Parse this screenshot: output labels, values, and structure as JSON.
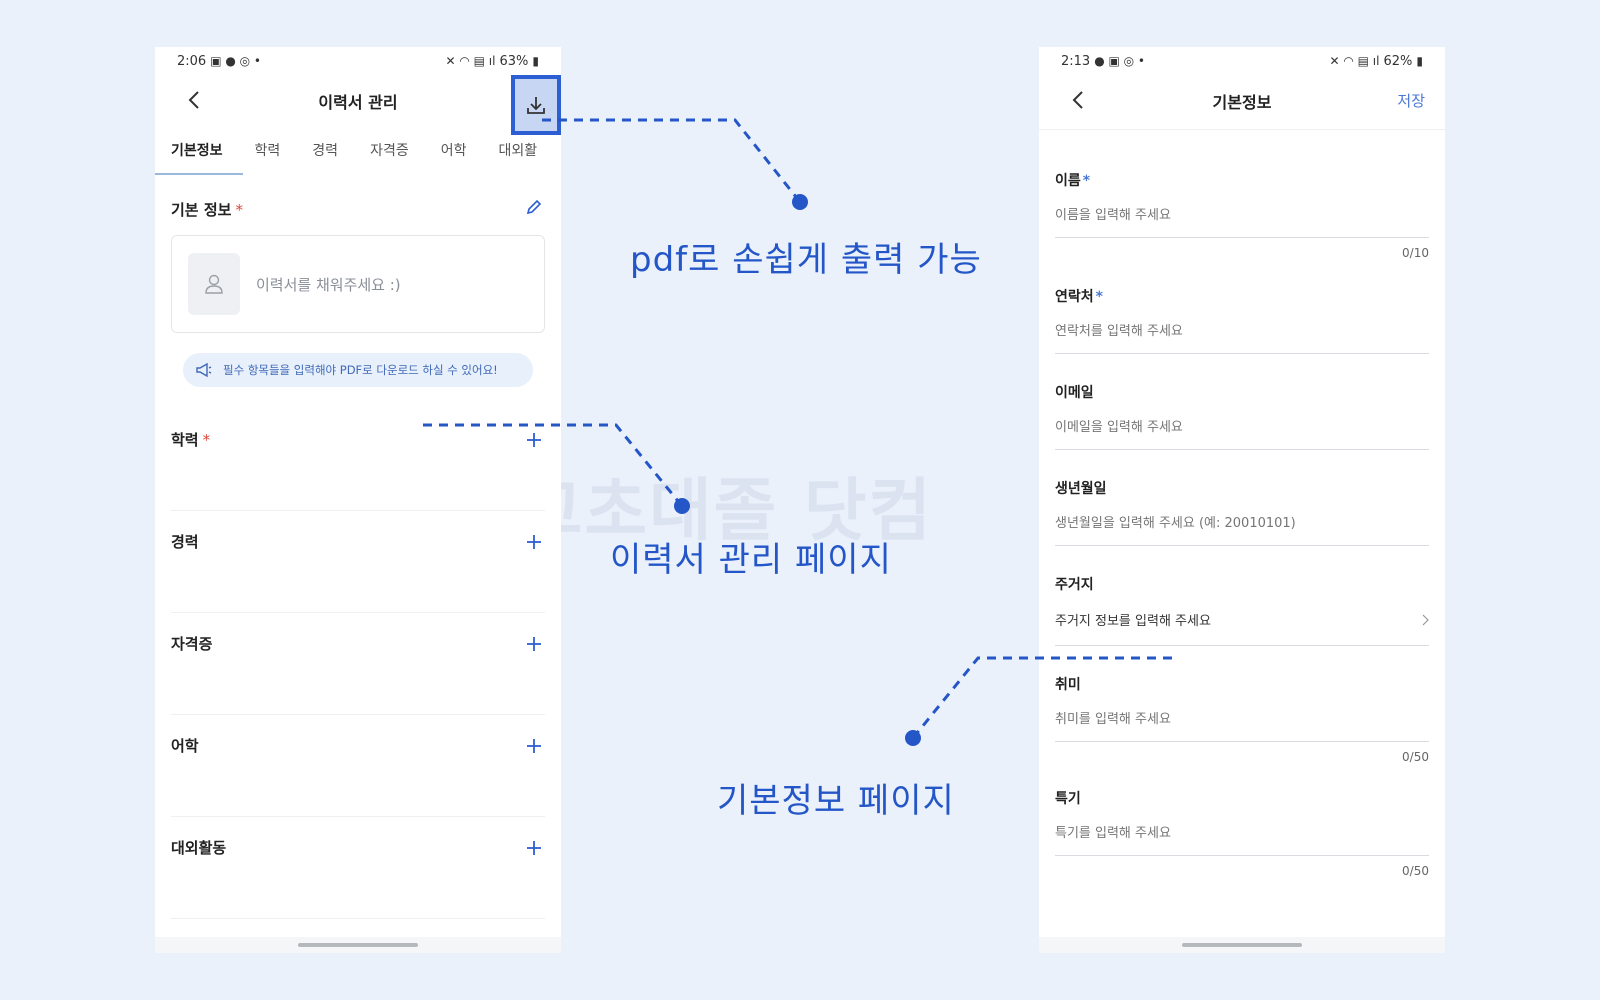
{
  "left_phone": {
    "status": {
      "time": "2:06",
      "battery": "63%"
    },
    "title": "이력서 관리",
    "tabs": [
      {
        "label": "기본정보"
      },
      {
        "label": "학력"
      },
      {
        "label": "경력"
      },
      {
        "label": "자격증"
      },
      {
        "label": "어학"
      },
      {
        "label": "대외활"
      }
    ],
    "basic_section": {
      "title": "기본 정보",
      "required": "*"
    },
    "profile_placeholder": "이력서를 채워주세요 :)",
    "notice": "필수 항목들을 입력해야 PDF로 다운로드 하실 수 있어요!",
    "sections": [
      {
        "title": "학력",
        "required": "*"
      },
      {
        "title": "경력",
        "required": ""
      },
      {
        "title": "자격증",
        "required": ""
      },
      {
        "title": "어학",
        "required": ""
      },
      {
        "title": "대외활동",
        "required": ""
      }
    ]
  },
  "right_phone": {
    "status": {
      "time": "2:13",
      "battery": "62%"
    },
    "title": "기본정보",
    "save_label": "저장",
    "fields": {
      "name": {
        "label": "이름",
        "required": "*",
        "placeholder": "이름을 입력해 주세요",
        "count": "0/10"
      },
      "contact": {
        "label": "연락처",
        "required": "*",
        "placeholder": "연락처를 입력해 주세요"
      },
      "email": {
        "label": "이메일",
        "placeholder": "이메일을 입력해 주세요"
      },
      "birth": {
        "label": "생년월일",
        "placeholder": "생년월일을 입력해 주세요 (예: 20010101)"
      },
      "address": {
        "label": "주거지",
        "value": "주거지 정보를 입력해 주세요"
      },
      "hobby": {
        "label": "취미",
        "placeholder": "취미를 입력해 주세요",
        "count": "0/50"
      },
      "skill": {
        "label": "특기",
        "placeholder": "특기를 입력해 주세요",
        "count": "0/50"
      }
    }
  },
  "annotations": {
    "pdf": "pdf로 손쉽게 출력 가능",
    "resume": "이력서 관리 페이지",
    "basic": "기본정보 페이지"
  },
  "watermark": "고초대졸 닷컴",
  "colors": {
    "accent": "#2456c8",
    "background": "#eaf1fb",
    "link": "#4a78d9"
  }
}
